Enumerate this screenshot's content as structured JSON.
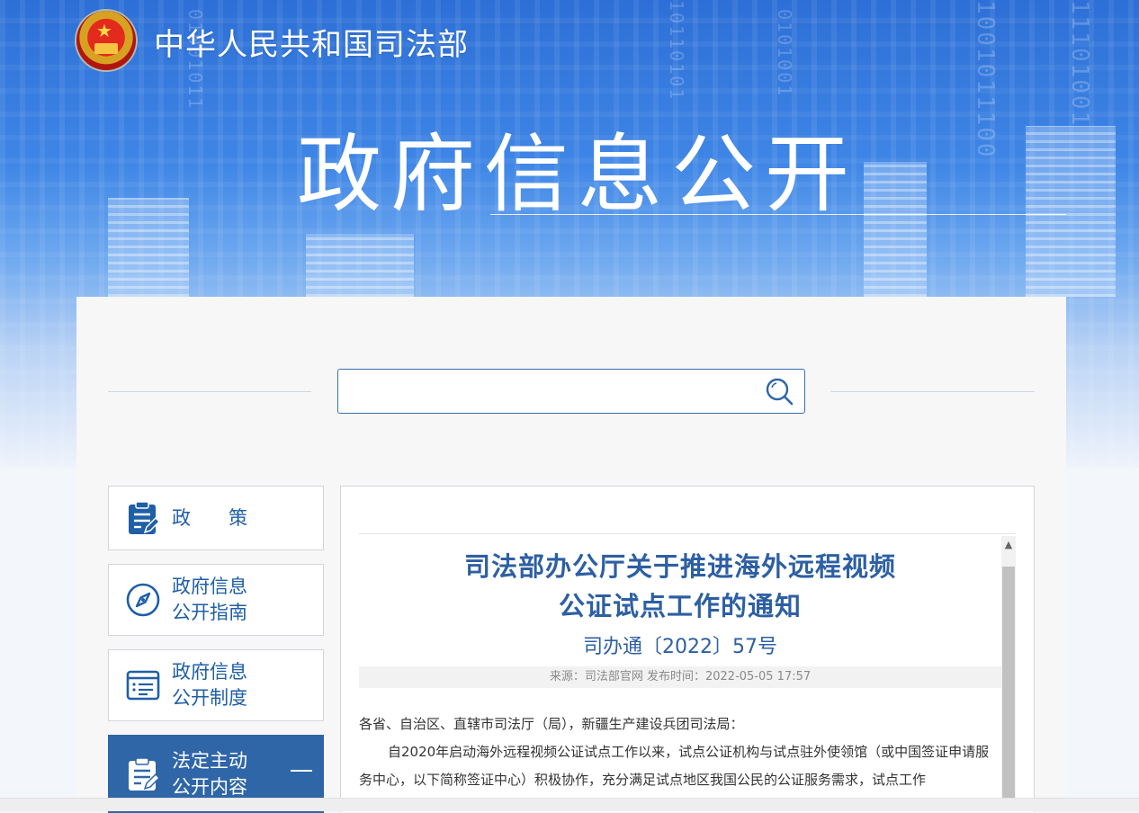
{
  "header": {
    "site_title": "中华人民共和国司法部",
    "banner_title": "政府信息公开"
  },
  "search": {
    "placeholder": ""
  },
  "sidebar": {
    "items": [
      {
        "line1": "政　　策",
        "line2": "",
        "icon": "clipboard-edit-icon",
        "active": false
      },
      {
        "line1": "政府信息",
        "line2": "公开指南",
        "icon": "compass-icon",
        "active": false
      },
      {
        "line1": "政府信息",
        "line2": "公开制度",
        "icon": "list-icon",
        "active": false
      },
      {
        "line1": "法定主动",
        "line2": "公开内容",
        "icon": "clipboard-edit-icon",
        "active": true,
        "toggle": "—"
      }
    ]
  },
  "article": {
    "title_line1": "司法部办公厅关于推进海外远程视频",
    "title_line2": "公证试点工作的通知",
    "doc_number": "司办通〔2022〕57号",
    "meta": "来源：司法部官网 发布时间：2022-05-05 17:57",
    "salutation": "各省、自治区、直辖市司法厅（局），新疆生产建设兵团司法局：",
    "paragraph1": "自2020年启动海外远程视频公证试点工作以来，试点公证机构与试点驻外使领馆（或中国签证申请服务中心，以下简称签证中心）积极协作，充分满足试点地区我国公民的公证服务需求，试点工作"
  },
  "colors": {
    "accent": "#2f66a8",
    "title_blue": "#2d5fa3",
    "banner_top": "#2d6fd6"
  }
}
